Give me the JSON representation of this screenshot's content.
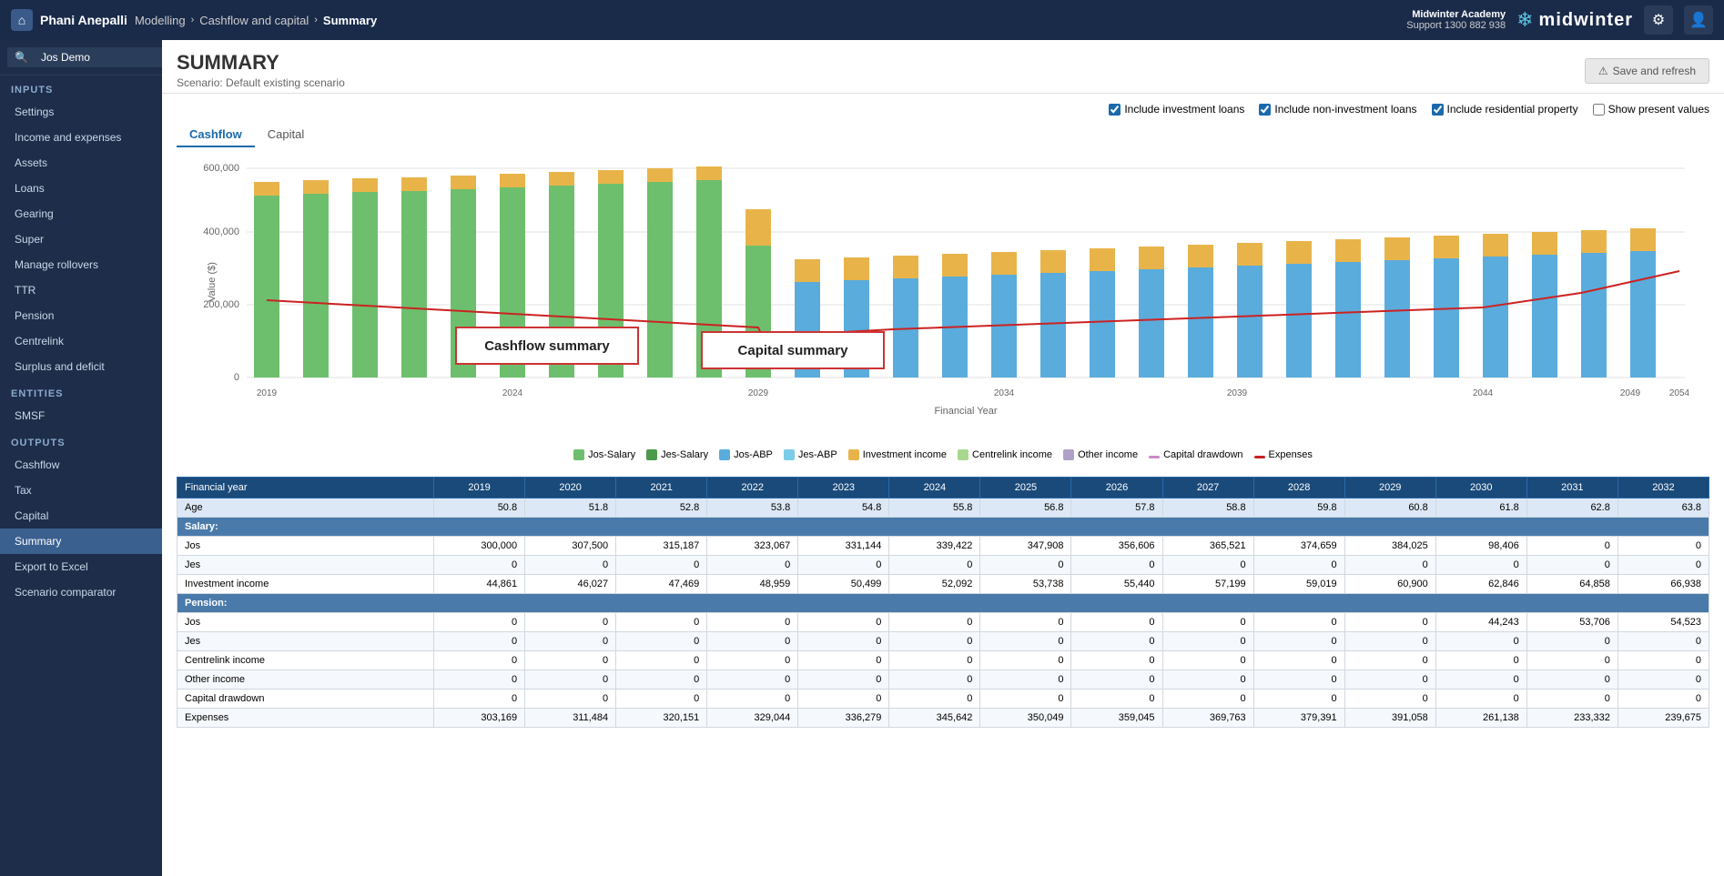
{
  "topNav": {
    "home_icon": "⌂",
    "user_name": "Phani Anepalli",
    "breadcrumb": [
      "Modelling",
      "Cashflow and capital",
      "Summary"
    ],
    "company": "Midwinter Academy",
    "support": "Support 1300 882 938",
    "brand": "midwinter",
    "gear_icon": "⚙",
    "user_icon": "👤",
    "snowflake_icon": "❄"
  },
  "sidebar": {
    "search_placeholder": "Jos Demo",
    "search_btn": "🔍",
    "inputs_label": "INPUTS",
    "items_inputs": [
      "Settings",
      "Income and expenses",
      "Assets",
      "Loans",
      "Gearing",
      "Super",
      "Manage rollovers",
      "TTR",
      "Pension",
      "Centrelink",
      "Surplus and deficit"
    ],
    "entities_label": "ENTITIES",
    "items_entities": [
      "SMSF"
    ],
    "outputs_label": "OUTPUTS",
    "items_outputs": [
      "Cashflow",
      "Tax",
      "Capital",
      "Summary",
      "Export to Excel",
      "Scenario comparator"
    ]
  },
  "page": {
    "title": "SUMMARY",
    "subtitle": "Scenario: Default existing scenario",
    "save_btn": "Save and refresh"
  },
  "chartOptions": {
    "include_investment": "Include investment loans",
    "include_non_investment": "Include non-investment loans",
    "include_residential": "Include residential property",
    "show_present": "Show present values"
  },
  "chartTabs": [
    "Cashflow",
    "Capital"
  ],
  "chartAnnotations": {
    "cashflow": "Cashflow summary",
    "capital": "Capital summary"
  },
  "legend": [
    {
      "label": "Jos-Salary",
      "color": "#6dbf6d",
      "type": "bar"
    },
    {
      "label": "Jes-Salary",
      "color": "#4a9a4a",
      "type": "bar"
    },
    {
      "label": "Jos-ABP",
      "color": "#5aacdc",
      "type": "bar"
    },
    {
      "label": "Jes-ABP",
      "color": "#5aacdc",
      "type": "bar"
    },
    {
      "label": "Investment income",
      "color": "#e8b44a",
      "type": "bar"
    },
    {
      "label": "Centrelink income",
      "color": "#a8d890",
      "type": "bar"
    },
    {
      "label": "Other income",
      "color": "#9580b0",
      "type": "bar"
    },
    {
      "label": "Capital drawdown",
      "color": "#cc88cc",
      "type": "line"
    },
    {
      "label": "Expenses",
      "color": "#cc2222",
      "type": "line"
    }
  ],
  "table": {
    "headers": [
      "Financial year",
      "2019",
      "2020",
      "2021",
      "2022",
      "2023",
      "2024",
      "2025",
      "2026",
      "2027",
      "2028",
      "2029",
      "2030",
      "2031",
      "2032"
    ],
    "rows": [
      {
        "type": "age",
        "label": "Age",
        "values": [
          "50.8",
          "51.8",
          "52.8",
          "53.8",
          "54.8",
          "55.8",
          "56.8",
          "57.8",
          "58.8",
          "59.8",
          "60.8",
          "61.8",
          "62.8",
          "63.8"
        ]
      },
      {
        "type": "section",
        "label": "Salary:",
        "values": [
          "",
          "",
          "",
          "",
          "",
          "",
          "",
          "",
          "",
          "",
          "",
          "",
          "",
          ""
        ]
      },
      {
        "type": "data",
        "label": "Jos",
        "values": [
          "300,000",
          "307,500",
          "315,187",
          "323,067",
          "331,144",
          "339,422",
          "347,908",
          "356,606",
          "365,521",
          "374,659",
          "384,025",
          "98,406",
          "0",
          "0"
        ]
      },
      {
        "type": "data",
        "label": "Jes",
        "values": [
          "0",
          "0",
          "0",
          "0",
          "0",
          "0",
          "0",
          "0",
          "0",
          "0",
          "0",
          "0",
          "0",
          "0"
        ]
      },
      {
        "type": "data",
        "label": "Investment income",
        "values": [
          "44,861",
          "46,027",
          "47,469",
          "48,959",
          "50,499",
          "52,092",
          "53,738",
          "55,440",
          "57,199",
          "59,019",
          "60,900",
          "62,846",
          "64,858",
          "66,938"
        ]
      },
      {
        "type": "section",
        "label": "Pension:",
        "values": [
          "",
          "",
          "",
          "",
          "",
          "",
          "",
          "",
          "",
          "",
          "",
          "",
          "",
          ""
        ]
      },
      {
        "type": "data",
        "label": "Jos",
        "values": [
          "0",
          "0",
          "0",
          "0",
          "0",
          "0",
          "0",
          "0",
          "0",
          "0",
          "0",
          "44,243",
          "53,706",
          "54,523"
        ]
      },
      {
        "type": "data",
        "label": "Jes",
        "values": [
          "0",
          "0",
          "0",
          "0",
          "0",
          "0",
          "0",
          "0",
          "0",
          "0",
          "0",
          "0",
          "0",
          "0"
        ]
      },
      {
        "type": "data",
        "label": "Centrelink income",
        "values": [
          "0",
          "0",
          "0",
          "0",
          "0",
          "0",
          "0",
          "0",
          "0",
          "0",
          "0",
          "0",
          "0",
          "0"
        ]
      },
      {
        "type": "data",
        "label": "Other income",
        "values": [
          "0",
          "0",
          "0",
          "0",
          "0",
          "0",
          "0",
          "0",
          "0",
          "0",
          "0",
          "0",
          "0",
          "0"
        ]
      },
      {
        "type": "data",
        "label": "Capital drawdown",
        "values": [
          "0",
          "0",
          "0",
          "0",
          "0",
          "0",
          "0",
          "0",
          "0",
          "0",
          "0",
          "0",
          "0",
          "0"
        ]
      },
      {
        "type": "data",
        "label": "Expenses",
        "values": [
          "303,169",
          "311,484",
          "320,151",
          "329,044",
          "336,279",
          "345,642",
          "350,049",
          "359,045",
          "369,763",
          "379,391",
          "391,058",
          "261,138",
          "233,332",
          "239,675"
        ]
      }
    ]
  }
}
